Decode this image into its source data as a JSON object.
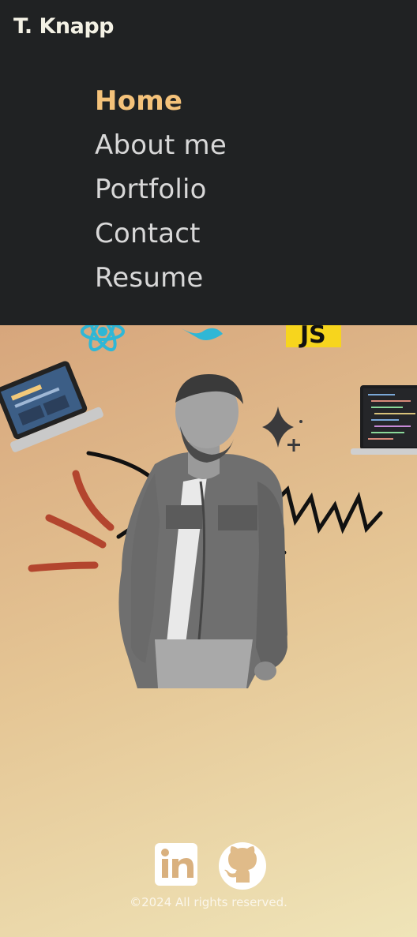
{
  "brand": {
    "name": "T. Knapp"
  },
  "nav": {
    "items": [
      {
        "label": "Home",
        "active": true
      },
      {
        "label": "About me",
        "active": false
      },
      {
        "label": "Portfolio",
        "active": false
      },
      {
        "label": "Contact",
        "active": false
      },
      {
        "label": "Resume",
        "active": false
      }
    ]
  },
  "hero": {
    "badges": [
      "react-icon",
      "tailwind-icon",
      "js-icon"
    ],
    "js_badge_text": "JS",
    "photo": "portrait-photo"
  },
  "footer": {
    "social": [
      {
        "name": "linkedin-icon"
      },
      {
        "name": "github-icon"
      }
    ],
    "copyright": "©2024 All rights reserved."
  },
  "colors": {
    "topbar": "#202223",
    "active_nav": "#f4c27a",
    "nav_text": "#d8d8d8",
    "js_yellow": "#f7d51d"
  }
}
